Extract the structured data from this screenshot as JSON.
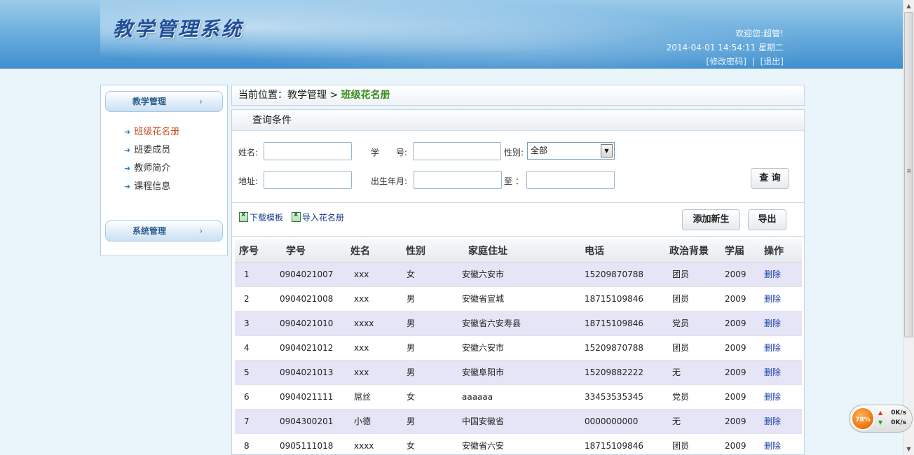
{
  "header": {
    "logo": "教学管理系统",
    "welcome": "欢迎您:超管!",
    "datetime": "2014-04-01 14:54:11  星期二",
    "change_password": "[修改密码]",
    "separator": "|",
    "logout": "[退出]"
  },
  "sidebar": {
    "group1": "教学管理",
    "group2": "系统管理",
    "items": [
      {
        "label": "班级花名册"
      },
      {
        "label": "班委成员"
      },
      {
        "label": "教师简介"
      },
      {
        "label": "课程信息"
      }
    ]
  },
  "breadcrumb": {
    "prefix": "当前位置：教学管理 > ",
    "current": "班级花名册"
  },
  "query": {
    "title": "查询条件",
    "name_label": "姓名:",
    "id_label": "学　　号:",
    "gender_label": "性别:",
    "gender_value": "全部",
    "address_label": "地址:",
    "birth_label": "出生年月:",
    "to_label": "至 ：",
    "search_button": "查 询"
  },
  "toolbar": {
    "download_template": "下载模板",
    "import_roster": "导入花名册",
    "add_student": "添加新生",
    "export": "导出"
  },
  "table": {
    "columns": [
      "序号",
      "学号",
      "姓名",
      "性别",
      "家庭住址",
      "电话",
      "政治背景",
      "学届",
      "操作"
    ],
    "rows": [
      [
        "1",
        "0904021007",
        "xxx",
        "女",
        "安徽六安市",
        "15209870788",
        "团员",
        "2009",
        "删除"
      ],
      [
        "2",
        "0904021008",
        "xxx",
        "男",
        "安徽省宣城",
        "18715109846",
        "团员",
        "2009",
        "删除"
      ],
      [
        "3",
        "0904021010",
        "xxxx",
        "男",
        "安徽省六安寿县",
        "18715109846",
        "党员",
        "2009",
        "删除"
      ],
      [
        "4",
        "0904021012",
        "xxx",
        "男",
        "安徽六安市",
        "15209870788",
        "团员",
        "2009",
        "删除"
      ],
      [
        "5",
        "0904021013",
        "xxx",
        "男",
        "安徽阜阳市",
        "15209882222",
        "无",
        "2009",
        "删除"
      ],
      [
        "6",
        "0904021111",
        "屌丝",
        "女",
        "aaaaaa",
        "33453535345",
        "党员",
        "2009",
        "删除"
      ],
      [
        "7",
        "0904300201",
        "小德",
        "男",
        "中国安徽省",
        "0000000000",
        "无",
        "2009",
        "删除"
      ],
      [
        "8",
        "0905111018",
        "xxxx",
        "女",
        "安徽省六安",
        "18715109846",
        "团员",
        "2009",
        "删除"
      ]
    ]
  },
  "net_widget": {
    "percent": "78%",
    "up": "0K/s",
    "down": "0K/s"
  }
}
